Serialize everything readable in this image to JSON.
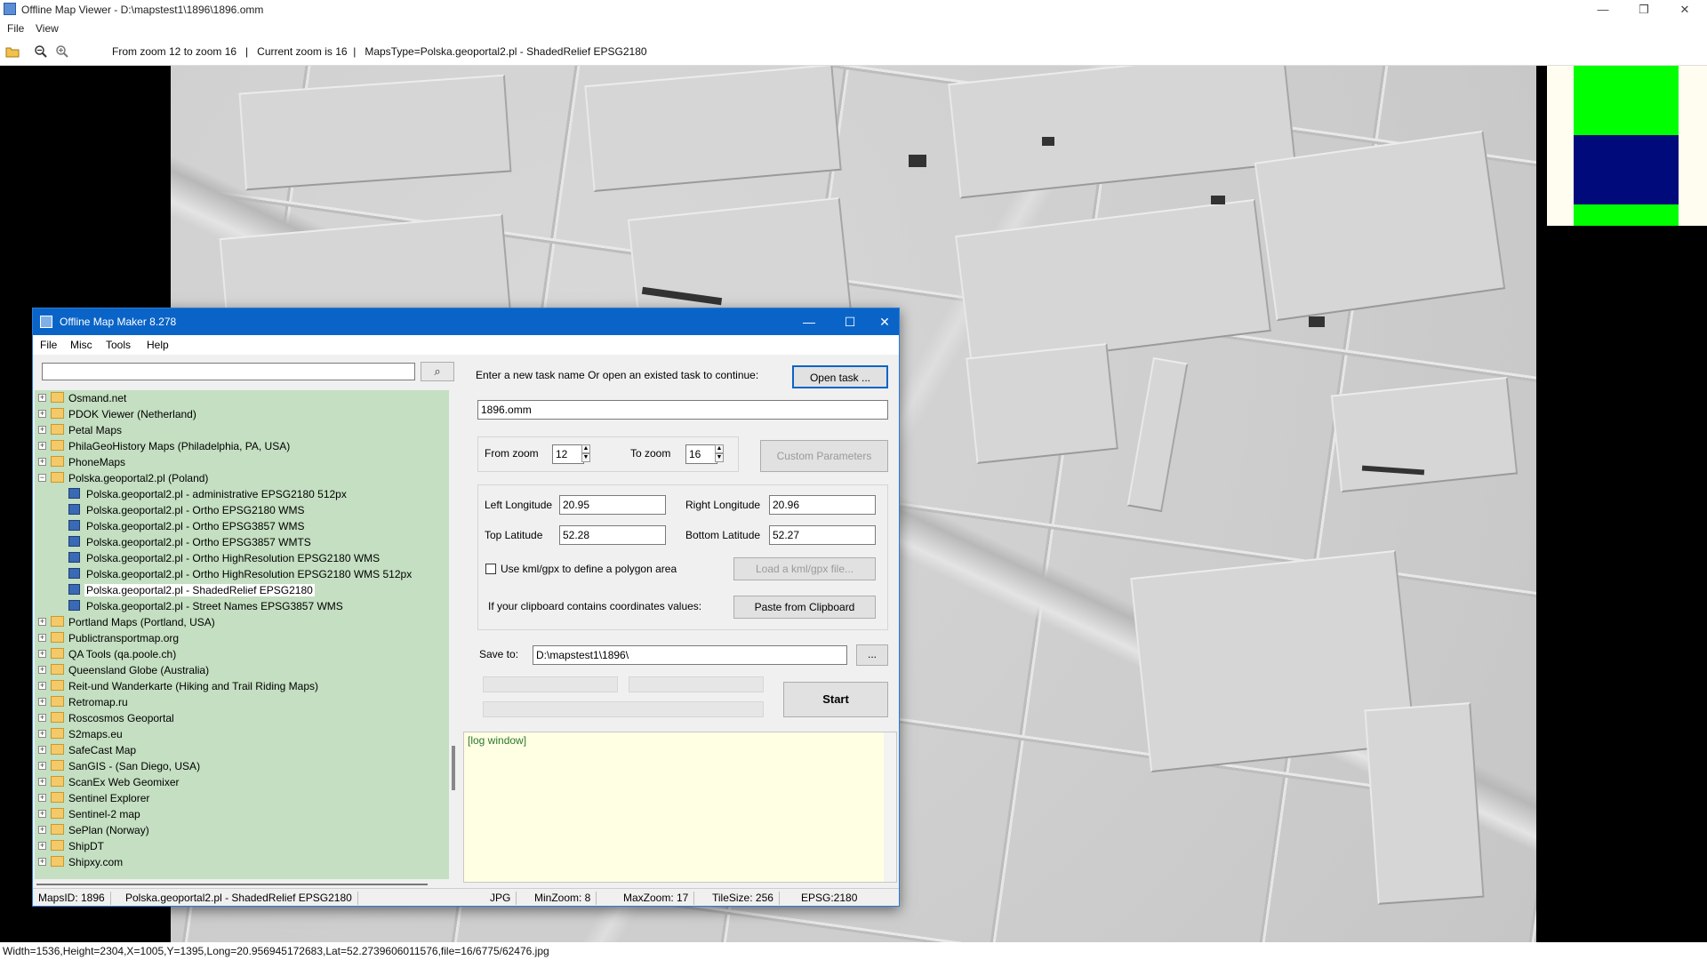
{
  "viewer": {
    "title": "Offline Map Viewer - D:\\mapstest1\\1896\\1896.omm",
    "menu": [
      "File",
      "View"
    ],
    "toolbar_status": "From zoom 12 to zoom 16   |   Current zoom is 16  |   MapsType=Polska.geoportal2.pl - ShadedRelief EPSG2180",
    "statusbar": "Width=1536,Height=2304,X=1005,Y=1395,Long=20.956945172683,Lat=52.2739606011576,file=16/6775/62476.jpg",
    "icons": [
      "open-folder-icon",
      "zoom-out-icon",
      "zoom-in-icon"
    ],
    "window_buttons": [
      "—",
      "❐",
      "✕"
    ]
  },
  "legend_colors": {
    "top": "#00ff00",
    "middle": "#000a7a",
    "bottom": "#00ff00"
  },
  "dialog": {
    "title": "Offline Map Maker 8.278",
    "menu": [
      "File",
      "Misc",
      "Tools",
      "Help"
    ],
    "window_buttons": [
      "—",
      "☐",
      "✕"
    ],
    "search": {
      "value": "",
      "button_icon": "search-icon",
      "button_glyph": "⌕"
    },
    "tree": [
      {
        "label": "Osmand.net",
        "type": "folder",
        "expanded": false
      },
      {
        "label": "PDOK Viewer (Netherland)",
        "type": "folder",
        "expanded": false
      },
      {
        "label": "Petal Maps",
        "type": "folder",
        "expanded": false
      },
      {
        "label": "PhilaGeoHistory Maps (Philadelphia, PA, USA)",
        "type": "folder",
        "expanded": false
      },
      {
        "label": "PhoneMaps",
        "type": "folder",
        "expanded": false
      },
      {
        "label": "Polska.geoportal2.pl (Poland)",
        "type": "folder",
        "expanded": true
      },
      {
        "label": "Polska.geoportal2.pl - administrative EPSG2180 512px",
        "type": "map"
      },
      {
        "label": "Polska.geoportal2.pl - Ortho EPSG2180 WMS",
        "type": "map"
      },
      {
        "label": "Polska.geoportal2.pl - Ortho EPSG3857 WMS",
        "type": "map"
      },
      {
        "label": "Polska.geoportal2.pl - Ortho EPSG3857 WMTS",
        "type": "map"
      },
      {
        "label": "Polska.geoportal2.pl - Ortho HighResolution EPSG2180 WMS",
        "type": "map"
      },
      {
        "label": "Polska.geoportal2.pl - Ortho HighResolution EPSG2180 WMS 512px",
        "type": "map"
      },
      {
        "label": "Polska.geoportal2.pl - ShadedRelief EPSG2180",
        "type": "map",
        "selected": true
      },
      {
        "label": "Polska.geoportal2.pl - Street Names EPSG3857 WMS",
        "type": "map"
      },
      {
        "label": "Portland Maps (Portland, USA)",
        "type": "folder",
        "expanded": false
      },
      {
        "label": "Publictransportmap.org",
        "type": "folder",
        "expanded": false
      },
      {
        "label": "QA Tools (qa.poole.ch)",
        "type": "folder",
        "expanded": false
      },
      {
        "label": "Queensland Globe (Australia)",
        "type": "folder",
        "expanded": false
      },
      {
        "label": "Reit-und Wanderkarte (Hiking and Trail Riding Maps)",
        "type": "folder",
        "expanded": false
      },
      {
        "label": "Retromap.ru",
        "type": "folder",
        "expanded": false
      },
      {
        "label": "Roscosmos Geoportal",
        "type": "folder",
        "expanded": false
      },
      {
        "label": "S2maps.eu",
        "type": "folder",
        "expanded": false
      },
      {
        "label": "SafeCast Map",
        "type": "folder",
        "expanded": false
      },
      {
        "label": "SanGIS - (San Diego, USA)",
        "type": "folder",
        "expanded": false
      },
      {
        "label": "ScanEx Web Geomixer",
        "type": "folder",
        "expanded": false
      },
      {
        "label": "Sentinel Explorer",
        "type": "folder",
        "expanded": false
      },
      {
        "label": "Sentinel-2 map",
        "type": "folder",
        "expanded": false
      },
      {
        "label": "SePlan (Norway)",
        "type": "folder",
        "expanded": false
      },
      {
        "label": "ShipDT",
        "type": "folder",
        "expanded": false
      },
      {
        "label": "Shipxy.com",
        "type": "folder",
        "expanded": false
      }
    ],
    "task_prompt": "Enter a new task name Or open an existed task to continue:",
    "open_task_label": "Open task ...",
    "task_name": "1896.omm",
    "from_zoom_label": "From zoom",
    "from_zoom": "12",
    "to_zoom_label": "To zoom",
    "to_zoom": "16",
    "custom_params_label": "Custom Parameters",
    "left_lon_label": "Left Longitude",
    "left_lon": "20.95",
    "right_lon_label": "Right Longitude",
    "right_lon": "20.96",
    "top_lat_label": "Top Latitude",
    "top_lat": "52.28",
    "bottom_lat_label": "Bottom Latitude",
    "bottom_lat": "52.27",
    "kml_label": "Use kml/gpx to define a polygon area",
    "kml_checked": false,
    "load_kml_label": "Load a kml/gpx file...",
    "clipboard_prompt": "If your clipboard contains coordinates values:",
    "paste_label": "Paste from Clipboard",
    "save_to_label": "Save to:",
    "save_to": "D:\\mapstest1\\1896\\",
    "browse_label": "...",
    "start_label": "Start",
    "log_text": "[log window]",
    "status": {
      "maps_id": "MapsID: 1896",
      "map_name": "Polska.geoportal2.pl - ShadedRelief EPSG2180",
      "format": "JPG",
      "min_zoom": "MinZoom: 8",
      "max_zoom": "MaxZoom: 17",
      "tile_size": "TileSize: 256",
      "epsg": "EPSG:2180"
    }
  }
}
